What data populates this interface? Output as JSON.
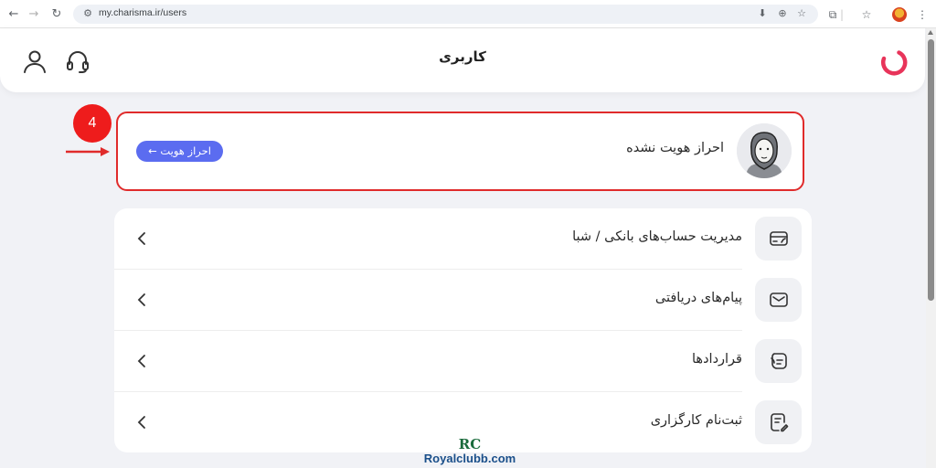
{
  "browser": {
    "url": "my.charisma.ir/users",
    "icons": [
      "back-icon",
      "forward-icon",
      "reload-icon",
      "site-settings-icon",
      "install-app-icon",
      "zoom-icon",
      "bookmark-star-icon",
      "extensions-icon",
      "bookmarks-icon",
      "profile-icon"
    ]
  },
  "header": {
    "title": "کاربری",
    "icons": [
      "profile-icon",
      "support-headset-icon",
      "charisma-logo"
    ],
    "brand_color": "#e8345a"
  },
  "identity": {
    "status": "احراز هویت نشده",
    "verify_button": "احراز هویت ←",
    "step_number": "4",
    "highlight_color": "#e02b2b",
    "button_color": "#5b6cf0"
  },
  "menu": {
    "items": [
      {
        "label": "مدیریت حساب‌های بانکی / شبا",
        "icon": "bank-card-icon"
      },
      {
        "label": "پیام‌های دریافتی",
        "icon": "envelope-icon"
      },
      {
        "label": "قراردادها",
        "icon": "contract-icon"
      },
      {
        "label": "ثبت‌نام کارگزاری",
        "icon": "registration-form-icon"
      }
    ]
  },
  "watermark": {
    "logo": "RC",
    "text": "Royalclubb.com"
  }
}
